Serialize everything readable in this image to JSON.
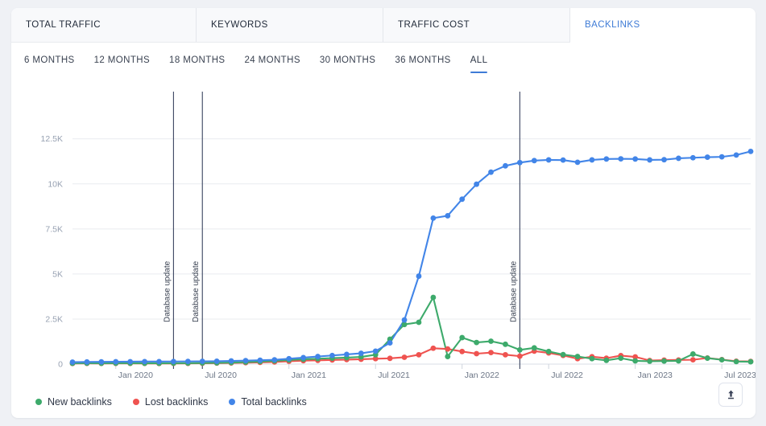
{
  "tabs": [
    {
      "label": "TOTAL TRAFFIC",
      "active": false
    },
    {
      "label": "KEYWORDS",
      "active": false
    },
    {
      "label": "TRAFFIC COST",
      "active": false
    },
    {
      "label": "BACKLINKS",
      "active": true
    }
  ],
  "periods": [
    {
      "label": "6 MONTHS",
      "selected": false
    },
    {
      "label": "12 MONTHS",
      "selected": false
    },
    {
      "label": "18 MONTHS",
      "selected": false
    },
    {
      "label": "24 MONTHS",
      "selected": false
    },
    {
      "label": "30 MONTHS",
      "selected": false
    },
    {
      "label": "36 MONTHS",
      "selected": false
    },
    {
      "label": "ALL",
      "selected": true
    }
  ],
  "legend": [
    {
      "label": "New backlinks",
      "color": "#3daa6b"
    },
    {
      "label": "Lost backlinks",
      "color": "#ef5350"
    },
    {
      "label": "Total backlinks",
      "color": "#4285e8"
    }
  ],
  "export": {
    "icon": "upload-icon",
    "title": "Export"
  },
  "annotations": [
    {
      "label": "Database update",
      "x_index": 7
    },
    {
      "label": "Database update",
      "x_index": 9
    },
    {
      "label": "Database update",
      "x_index": 31
    }
  ],
  "chart_data": {
    "type": "line",
    "title": "",
    "xlabel": "",
    "ylabel": "",
    "ylim": [
      0,
      13200
    ],
    "yticks": [
      0,
      2500,
      5000,
      7500,
      10000,
      12500
    ],
    "ytick_labels": [
      "0",
      "2.5K",
      "5K",
      "7.5K",
      "10K",
      "12.5K"
    ],
    "grid": true,
    "legend_position": "bottom-left",
    "x": [
      "Oct 2019",
      "Nov 2019",
      "Dec 2019",
      "Jan 2020",
      "Feb 2020",
      "Mar 2020",
      "Apr 2020",
      "May 2020",
      "Jun 2020",
      "Jul 2020",
      "Aug 2020",
      "Sep 2020",
      "Oct 2020",
      "Nov 2020",
      "Dec 2020",
      "Jan 2021",
      "Feb 2021",
      "Mar 2021",
      "Apr 2021",
      "May 2021",
      "Jun 2021",
      "Jul 2021",
      "Aug 2021",
      "Sep 2021",
      "Oct 2021",
      "Nov 2021",
      "Dec 2021",
      "Jan 2022",
      "Feb 2022",
      "Mar 2022",
      "Apr 2022",
      "May 2022",
      "Jun 2022",
      "Jul 2022",
      "Aug 2022",
      "Sep 2022",
      "Oct 2022",
      "Nov 2022",
      "Dec 2022",
      "Jan 2023",
      "Feb 2023",
      "Mar 2023",
      "Apr 2023",
      "May 2023",
      "Jun 2023",
      "Jul 2023",
      "Aug 2023",
      "Sep 2023"
    ],
    "xtick_labels": [
      "Jan 2020",
      "Jul 2020",
      "Jan 2021",
      "Jul 2021",
      "Jan 2022",
      "Jul 2022",
      "Jan 2023",
      "Jul 2023"
    ],
    "xtick_indices": [
      3,
      9,
      15,
      21,
      27,
      33,
      39,
      45
    ],
    "series": [
      {
        "name": "Total backlinks",
        "color": "#4285e8",
        "values": [
          110,
          120,
          125,
          130,
          135,
          140,
          140,
          145,
          150,
          155,
          160,
          175,
          195,
          215,
          240,
          300,
          360,
          420,
          480,
          540,
          600,
          720,
          1180,
          2450,
          4880,
          8100,
          8230,
          9150,
          9980,
          10650,
          11000,
          11180,
          11290,
          11330,
          11320,
          11200,
          11330,
          11380,
          11390,
          11380,
          11330,
          11340,
          11420,
          11450,
          11480,
          11500,
          11600,
          11800
        ]
      },
      {
        "name": "New backlinks",
        "color": "#3daa6b",
        "values": [
          45,
          50,
          48,
          52,
          50,
          48,
          46,
          50,
          55,
          60,
          70,
          85,
          110,
          140,
          180,
          230,
          270,
          300,
          330,
          360,
          400,
          520,
          1380,
          2200,
          2320,
          3700,
          420,
          1470,
          1200,
          1270,
          1100,
          790,
          900,
          700,
          530,
          420,
          300,
          210,
          330,
          180,
          160,
          170,
          180,
          560,
          330,
          240,
          140,
          130
        ]
      },
      {
        "name": "Lost backlinks",
        "color": "#ef5350",
        "values": [
          35,
          40,
          38,
          42,
          40,
          38,
          36,
          38,
          42,
          48,
          55,
          65,
          80,
          95,
          120,
          160,
          190,
          210,
          230,
          250,
          270,
          300,
          320,
          380,
          520,
          880,
          840,
          700,
          580,
          640,
          520,
          440,
          720,
          620,
          480,
          300,
          410,
          330,
          470,
          400,
          200,
          220,
          230,
          240,
          340,
          250,
          160,
          150
        ]
      }
    ]
  }
}
